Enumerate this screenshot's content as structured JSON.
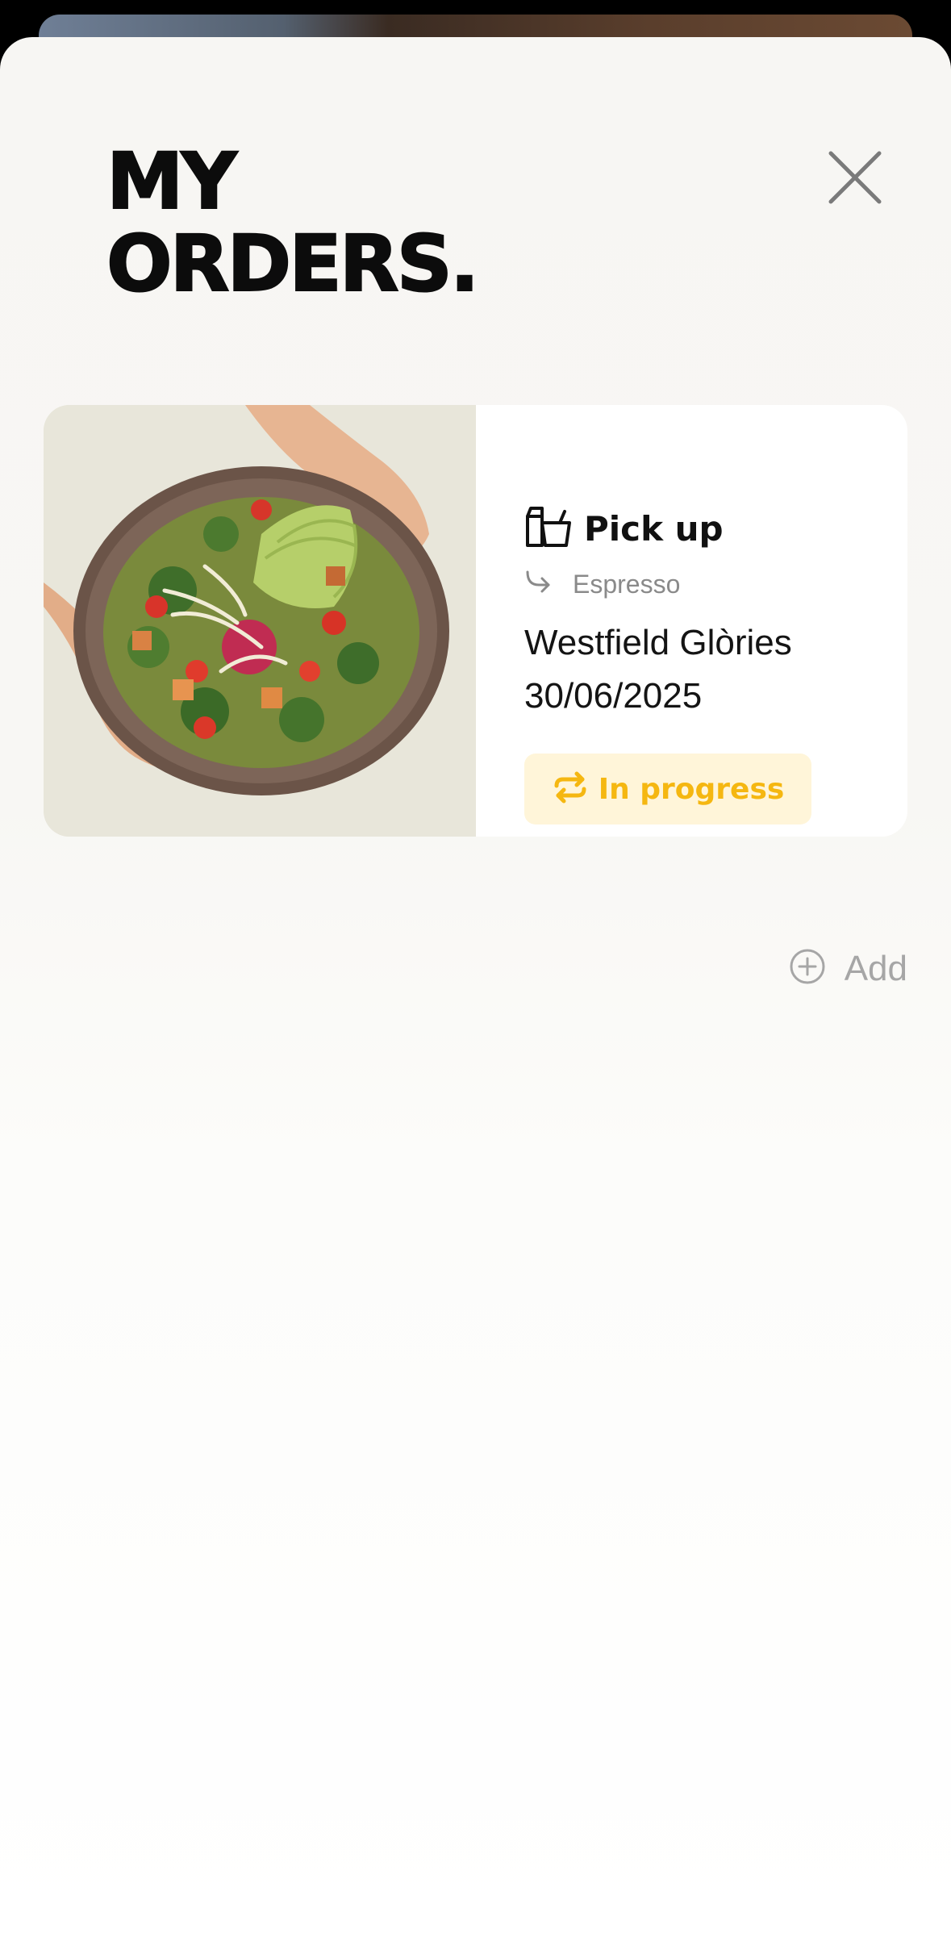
{
  "header": {
    "title": "MY\nORDERS."
  },
  "order": {
    "image_name": "salad-bowl-with-avocado",
    "type_icon": "takeaway-bag-icon",
    "type_label": "Pick up",
    "product_icon": "arrow-turn-right-icon",
    "product": "Espresso",
    "store": "Westfield Glòries",
    "date": "30/06/2025",
    "status_icon": "repeat-arrows-icon",
    "status": "In progress"
  },
  "actions": {
    "add_icon": "plus-circle-icon",
    "add_label": "Add"
  },
  "colors": {
    "status_text": "#f5b711",
    "status_background": "#fff5d9",
    "muted": "#a6a6a6",
    "sheet_background": "#f7f6f3"
  }
}
